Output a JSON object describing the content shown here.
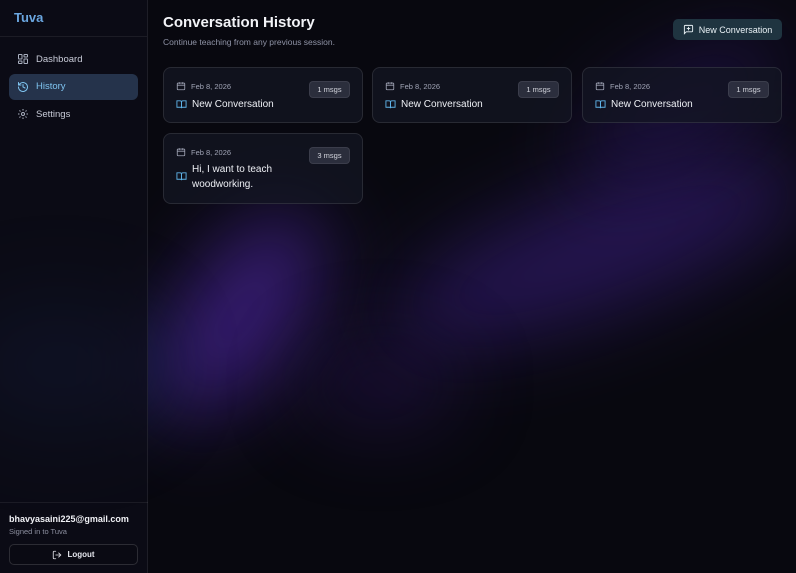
{
  "app": {
    "name": "Tuva"
  },
  "sidebar": {
    "items": [
      {
        "label": "Dashboard",
        "icon": "dashboard-icon"
      },
      {
        "label": "History",
        "icon": "history-icon",
        "active": true
      },
      {
        "label": "Settings",
        "icon": "gear-icon"
      }
    ]
  },
  "account": {
    "email": "bhavyasaini225@gmail.com",
    "status": "Signed in to Tuva",
    "logout_label": "Logout"
  },
  "page": {
    "title": "Conversation History",
    "subtitle": "Continue teaching from any previous session.",
    "new_button_label": "New Conversation"
  },
  "conversations": [
    {
      "date": "Feb 8, 2026",
      "title": "New Conversation",
      "count": "1 msgs"
    },
    {
      "date": "Feb 8, 2026",
      "title": "New Conversation",
      "count": "1 msgs"
    },
    {
      "date": "Feb 8, 2026",
      "title": "New Conversation",
      "count": "1 msgs"
    },
    {
      "date": "Feb 8, 2026",
      "title": "Hi, I want to teach woodworking.",
      "count": "3 msgs"
    }
  ],
  "colors": {
    "accent": "#7fc4f0",
    "brand": "#6aa6e0",
    "background": "#08080f",
    "button": "#1f3440"
  }
}
